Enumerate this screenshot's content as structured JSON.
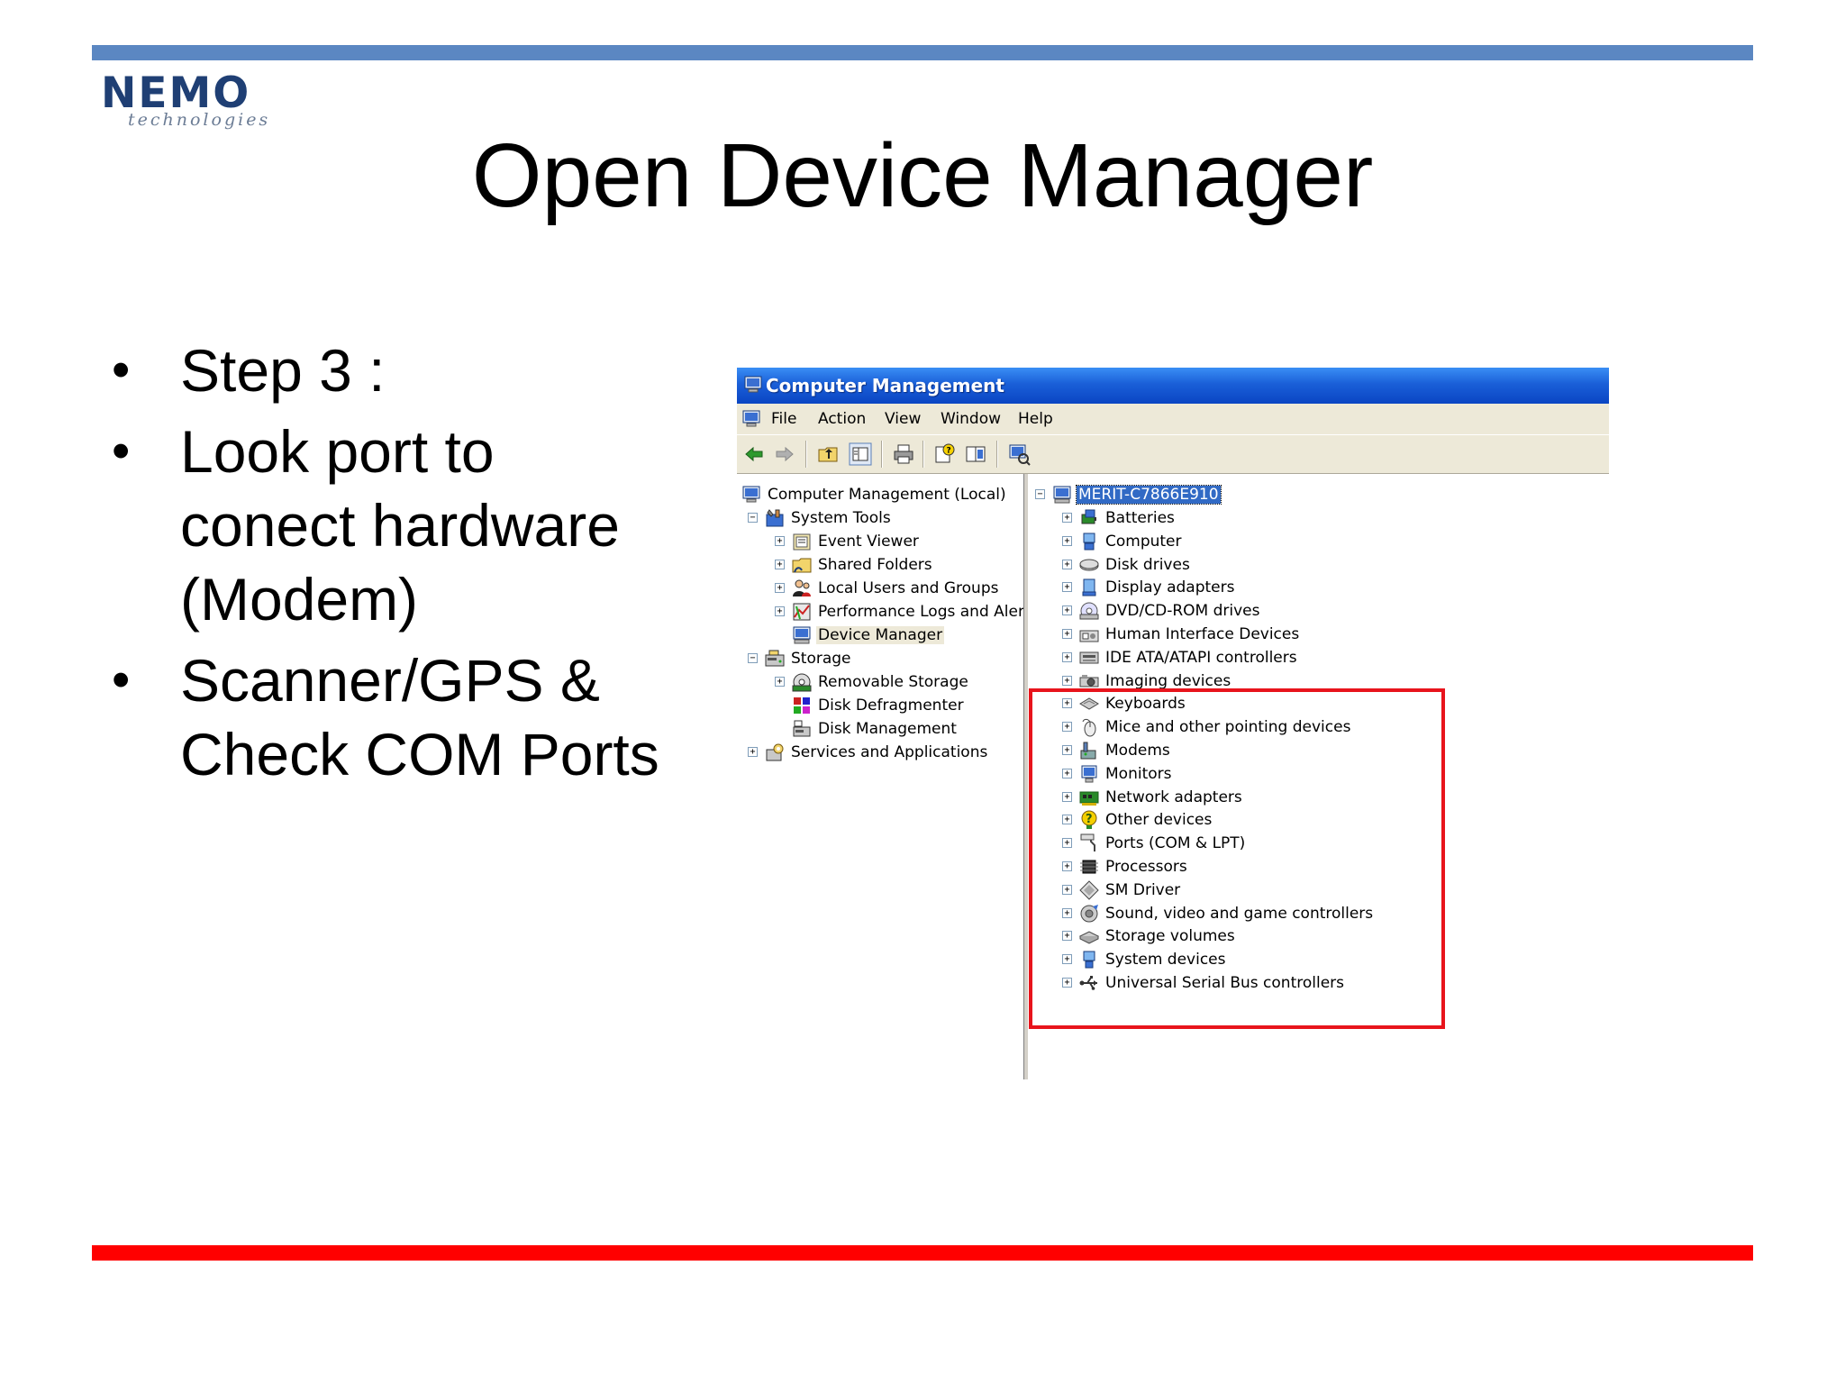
{
  "slide": {
    "logo": {
      "main": "NEMO",
      "sub": "technologies"
    },
    "title": "Open Device Manager",
    "bullets": [
      "Step 3 :",
      "Look port to conect hardware (Modem)",
      "Scanner/GPS & Check COM Ports"
    ],
    "colors": {
      "top_bar": "#5b87c2",
      "bottom_bar": "#ff0000",
      "highlight_box": "#e8141c"
    }
  },
  "window": {
    "title": "Computer Management",
    "menu": [
      "File",
      "Action",
      "View",
      "Window",
      "Help"
    ],
    "toolbar_icons": [
      "back-arrow-icon",
      "forward-arrow-icon",
      "up-folder-icon",
      "show-hide-tree-icon",
      "print-icon",
      "help-icon",
      "properties-icon",
      "scan-hardware-icon"
    ],
    "left_tree": [
      {
        "label": "Computer Management (Local)",
        "icon": "computer-management-icon"
      },
      {
        "label": "System Tools",
        "icon": "tools-icon"
      },
      {
        "label": "Event Viewer",
        "icon": "event-viewer-icon"
      },
      {
        "label": "Shared Folders",
        "icon": "shared-folder-icon"
      },
      {
        "label": "Local Users and Groups",
        "icon": "users-icon"
      },
      {
        "label": "Performance Logs and Alerts",
        "icon": "performance-icon"
      },
      {
        "label": "Device Manager",
        "icon": "device-manager-icon"
      },
      {
        "label": "Storage",
        "icon": "storage-icon"
      },
      {
        "label": "Removable Storage",
        "icon": "removable-storage-icon"
      },
      {
        "label": "Disk Defragmenter",
        "icon": "defrag-icon"
      },
      {
        "label": "Disk Management",
        "icon": "disk-management-icon"
      },
      {
        "label": "Services and Applications",
        "icon": "services-icon"
      }
    ],
    "device_root": "MERIT-C7866E910",
    "devices": [
      "Batteries",
      "Computer",
      "Disk drives",
      "Display adapters",
      "DVD/CD-ROM drives",
      "Human Interface Devices",
      "IDE ATA/ATAPI controllers",
      "Imaging devices",
      "Keyboards",
      "Mice and other pointing devices",
      "Modems",
      "Monitors",
      "Network adapters",
      "Other devices",
      "Ports (COM & LPT)",
      "Processors",
      "SM Driver",
      "Sound, video and game controllers",
      "Storage volumes",
      "System devices",
      "Universal Serial Bus controllers"
    ]
  }
}
